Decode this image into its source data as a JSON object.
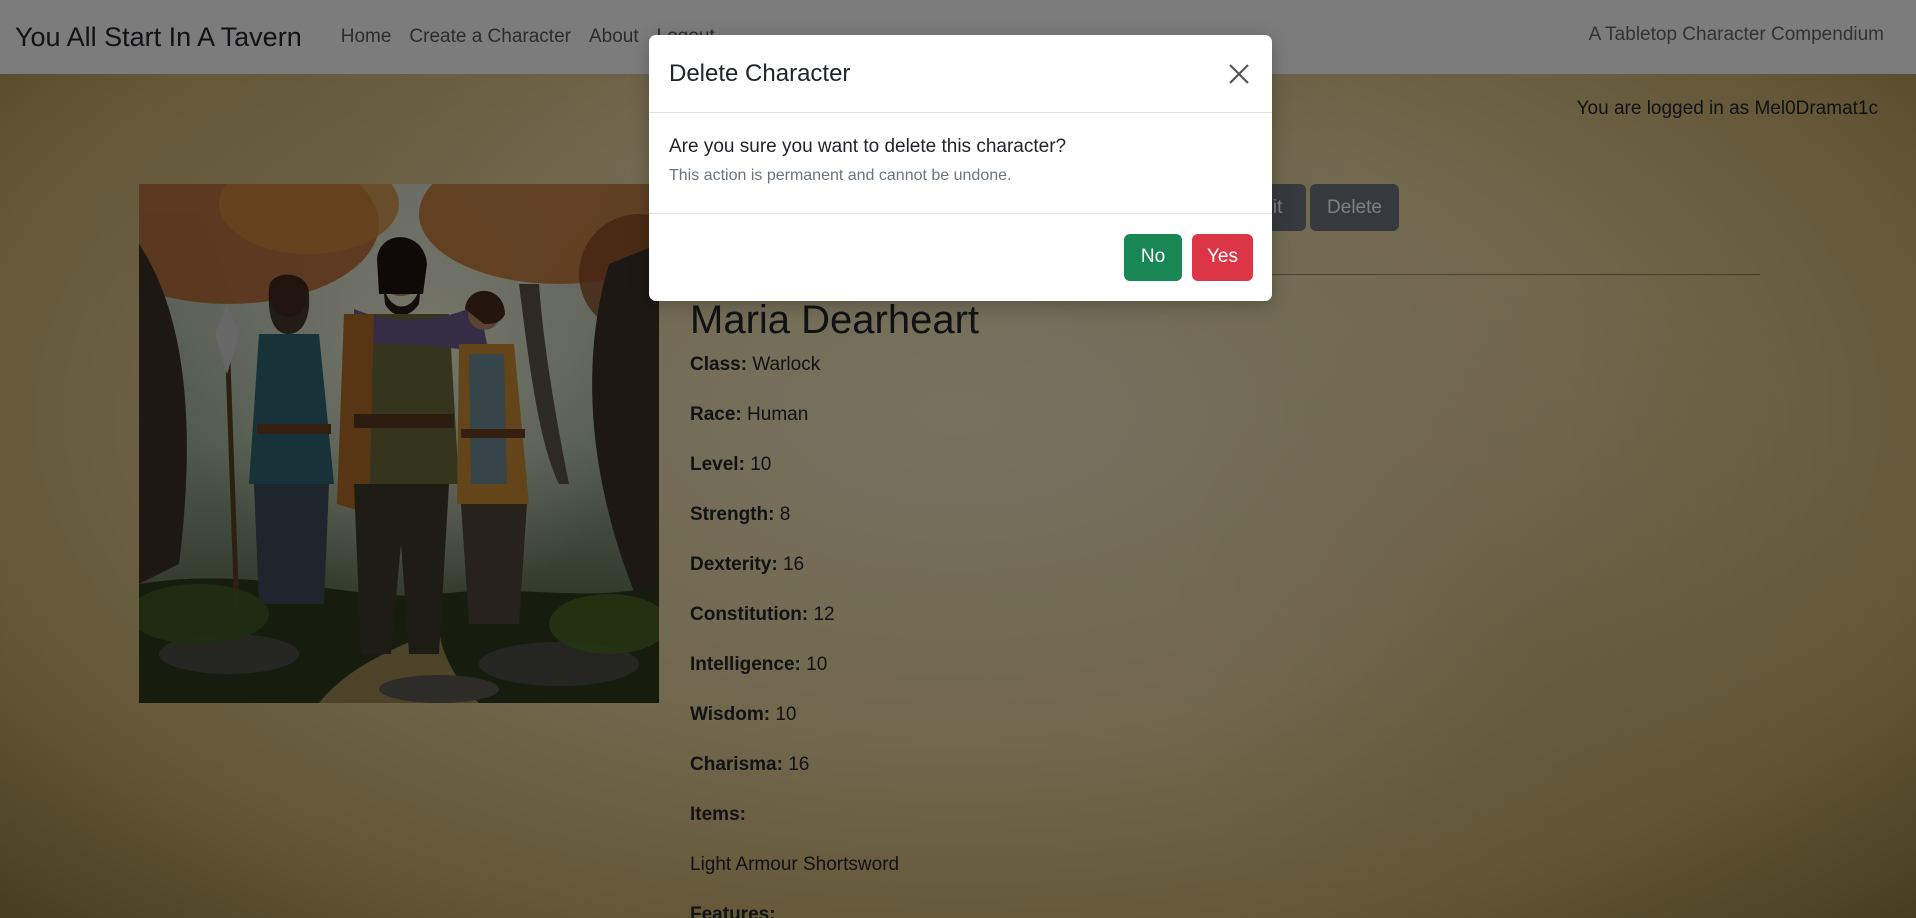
{
  "navbar": {
    "brand": "You All Start In A Tavern",
    "links": [
      "Home",
      "Create a Character",
      "About",
      "Logout"
    ],
    "tagline": "A Tabletop Character Compendium"
  },
  "session": {
    "logged_in_text": "You are logged in as Mel0Dramat1c"
  },
  "actions": {
    "edit_label": "Edit",
    "delete_label": "Delete"
  },
  "character": {
    "name": "Maria Dearheart",
    "stats": [
      {
        "label": "Class:",
        "value": "Warlock"
      },
      {
        "label": "Race:",
        "value": "Human"
      },
      {
        "label": "Level:",
        "value": "10"
      },
      {
        "label": "Strength:",
        "value": "8"
      },
      {
        "label": "Dexterity:",
        "value": "16"
      },
      {
        "label": "Constitution:",
        "value": "12"
      },
      {
        "label": "Intelligence:",
        "value": "10"
      },
      {
        "label": "Wisdom:",
        "value": "10"
      },
      {
        "label": "Charisma:",
        "value": "16"
      },
      {
        "label": "Items:",
        "value": ""
      }
    ],
    "items_text": "Light Armour Shortsword",
    "features_label": "Features:"
  },
  "modal": {
    "title": "Delete Character",
    "question": "Are you sure you want to delete this character?",
    "note": "This action is permanent and cannot be undone.",
    "no_label": "No",
    "yes_label": "Yes"
  },
  "colors": {
    "navbar_bg": "#f8f9fa",
    "btn_no": "#198754",
    "btn_yes": "#dc3545",
    "btn_secondary": "#6c757d"
  }
}
